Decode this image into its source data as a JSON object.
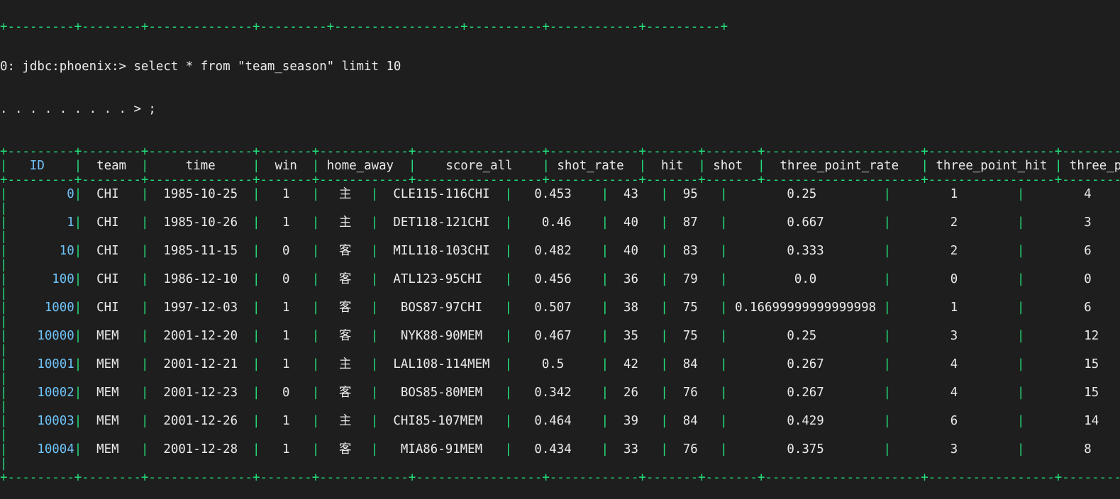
{
  "terminal": {
    "background_color": "#1e1e1e",
    "text_color": "#eaeaea",
    "border_color": "#24e07c",
    "id_color": "#6fc3f7",
    "prompt_line": "0: jdbc:phoenix:> select * from \"team_season\" limit 10",
    "continuation_line": ". . . . . . . . . > ;",
    "top_rule": "+---------+--------+--------------+---------+-----------------+----------+------------+----------+",
    "header_rule": "+---------+--------+--------------+-------+------------+-----------------+------------+-------+-------+---------------------+-----------------+------------------+",
    "bottom_rule": "+---------+--------+--------------+-------+------------+-----------------+------------+-------+-------+---------------------+-----------------+------------------+"
  },
  "table": {
    "columns": [
      {
        "key": "id",
        "label": "ID",
        "width": 9,
        "align": "right",
        "color": "id"
      },
      {
        "key": "team",
        "label": "team",
        "width": 8,
        "align": "center",
        "color": "txt"
      },
      {
        "key": "time",
        "label": "time",
        "width": 14,
        "align": "center",
        "color": "txt"
      },
      {
        "key": "win",
        "label": "win",
        "width": 7,
        "align": "center",
        "color": "txt"
      },
      {
        "key": "home_away",
        "label": "home_away",
        "width": 12,
        "align": "center",
        "color": "txt"
      },
      {
        "key": "score_all",
        "label": "score_all",
        "width": 17,
        "align": "center",
        "color": "txt"
      },
      {
        "key": "shot_rate",
        "label": "shot_rate",
        "width": 12,
        "align": "center",
        "color": "txt"
      },
      {
        "key": "hit",
        "label": "hit",
        "width": 7,
        "align": "center",
        "color": "txt"
      },
      {
        "key": "shot",
        "label": "shot",
        "width": 7,
        "align": "center",
        "color": "txt"
      },
      {
        "key": "three_point_rate",
        "label": "three_point_rate",
        "width": 21,
        "align": "center",
        "color": "txt"
      },
      {
        "key": "three_point_hit",
        "label": "three_point_hit",
        "width": 17,
        "align": "center",
        "color": "txt"
      },
      {
        "key": "three_point_shot",
        "label": "three_point_shot",
        "width": 18,
        "align": "center",
        "color": "txt"
      }
    ],
    "rows": [
      {
        "id": "0",
        "team": "CHI",
        "time": "1985-10-25",
        "win": "1",
        "home_away": "主",
        "score_all": "CLE115-116CHI",
        "shot_rate": "0.453",
        "hit": "43",
        "shot": "95",
        "three_point_rate": "0.25",
        "three_point_hit": "1",
        "three_point_shot": "4"
      },
      {
        "id": "1",
        "team": "CHI",
        "time": "1985-10-26",
        "win": "1",
        "home_away": "主",
        "score_all": "DET118-121CHI",
        "shot_rate": "0.46",
        "hit": "40",
        "shot": "87",
        "three_point_rate": "0.667",
        "three_point_hit": "2",
        "three_point_shot": "3"
      },
      {
        "id": "10",
        "team": "CHI",
        "time": "1985-11-15",
        "win": "0",
        "home_away": "客",
        "score_all": "MIL118-103CHI",
        "shot_rate": "0.482",
        "hit": "40",
        "shot": "83",
        "three_point_rate": "0.333",
        "three_point_hit": "2",
        "three_point_shot": "6"
      },
      {
        "id": "100",
        "team": "CHI",
        "time": "1986-12-10",
        "win": "0",
        "home_away": "客",
        "score_all": "ATL123-95CHI",
        "shot_rate": "0.456",
        "hit": "36",
        "shot": "79",
        "three_point_rate": "0.0",
        "three_point_hit": "0",
        "three_point_shot": "0"
      },
      {
        "id": "1000",
        "team": "CHI",
        "time": "1997-12-03",
        "win": "1",
        "home_away": "客",
        "score_all": "BOS87-97CHI",
        "shot_rate": "0.507",
        "hit": "38",
        "shot": "75",
        "three_point_rate": "0.16699999999999998",
        "three_point_hit": "1",
        "three_point_shot": "6"
      },
      {
        "id": "10000",
        "team": "MEM",
        "time": "2001-12-20",
        "win": "1",
        "home_away": "客",
        "score_all": "NYK88-90MEM",
        "shot_rate": "0.467",
        "hit": "35",
        "shot": "75",
        "three_point_rate": "0.25",
        "three_point_hit": "3",
        "three_point_shot": "12"
      },
      {
        "id": "10001",
        "team": "MEM",
        "time": "2001-12-21",
        "win": "1",
        "home_away": "主",
        "score_all": "LAL108-114MEM",
        "shot_rate": "0.5",
        "hit": "42",
        "shot": "84",
        "three_point_rate": "0.267",
        "three_point_hit": "4",
        "three_point_shot": "15"
      },
      {
        "id": "10002",
        "team": "MEM",
        "time": "2001-12-23",
        "win": "0",
        "home_away": "客",
        "score_all": "BOS85-80MEM",
        "shot_rate": "0.342",
        "hit": "26",
        "shot": "76",
        "three_point_rate": "0.267",
        "three_point_hit": "4",
        "three_point_shot": "15"
      },
      {
        "id": "10003",
        "team": "MEM",
        "time": "2001-12-26",
        "win": "1",
        "home_away": "主",
        "score_all": "CHI85-107MEM",
        "shot_rate": "0.464",
        "hit": "39",
        "shot": "84",
        "three_point_rate": "0.429",
        "three_point_hit": "6",
        "three_point_shot": "14"
      },
      {
        "id": "10004",
        "team": "MEM",
        "time": "2001-12-28",
        "win": "1",
        "home_away": "客",
        "score_all": "MIA86-91MEM",
        "shot_rate": "0.434",
        "hit": "33",
        "shot": "76",
        "three_point_rate": "0.375",
        "three_point_hit": "3",
        "three_point_shot": "8"
      }
    ]
  }
}
